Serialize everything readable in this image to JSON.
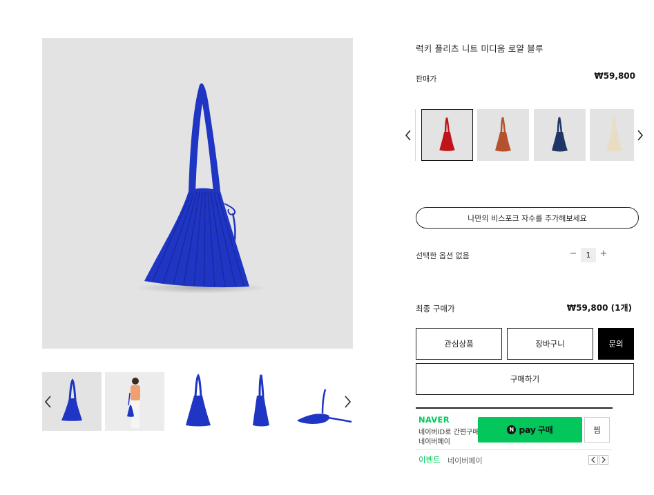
{
  "product": {
    "title": "럭키 플리츠 니트 미디움 로얄 블루",
    "price_label": "판매가",
    "price": "₩59,800"
  },
  "colors": {
    "options": [
      {
        "name": "red",
        "hex": "#c0141b"
      },
      {
        "name": "brick",
        "hex": "#b4522d"
      },
      {
        "name": "navy",
        "hex": "#1f3566"
      },
      {
        "name": "ivory",
        "hex": "#e8dcc2"
      }
    ],
    "selected_index": 0
  },
  "personalize": {
    "label": "나만의 비스포크 자수를 추가해보세요"
  },
  "option": {
    "label": "선택한 옵션 없음",
    "quantity": "1",
    "minus": "−",
    "plus": "+"
  },
  "total": {
    "label": "최종 구매가",
    "value": "₩59,800 (1개)"
  },
  "actions": {
    "wishlist": "관심상품",
    "cart": "장바구니",
    "inquiry": "문의",
    "buy": "구매하기"
  },
  "naver": {
    "brand": "NAVER",
    "desc_line1": "네이버ID로 간편구매",
    "desc_line2": "네이버페이",
    "pay_logo": "pay",
    "pay_label": "구매",
    "wish_label": "찜",
    "event_label": "이벤트",
    "event_desc": "네이버페이"
  },
  "theme": {
    "bag_color": "#1f35c4",
    "accent_green": "#03c75a"
  }
}
